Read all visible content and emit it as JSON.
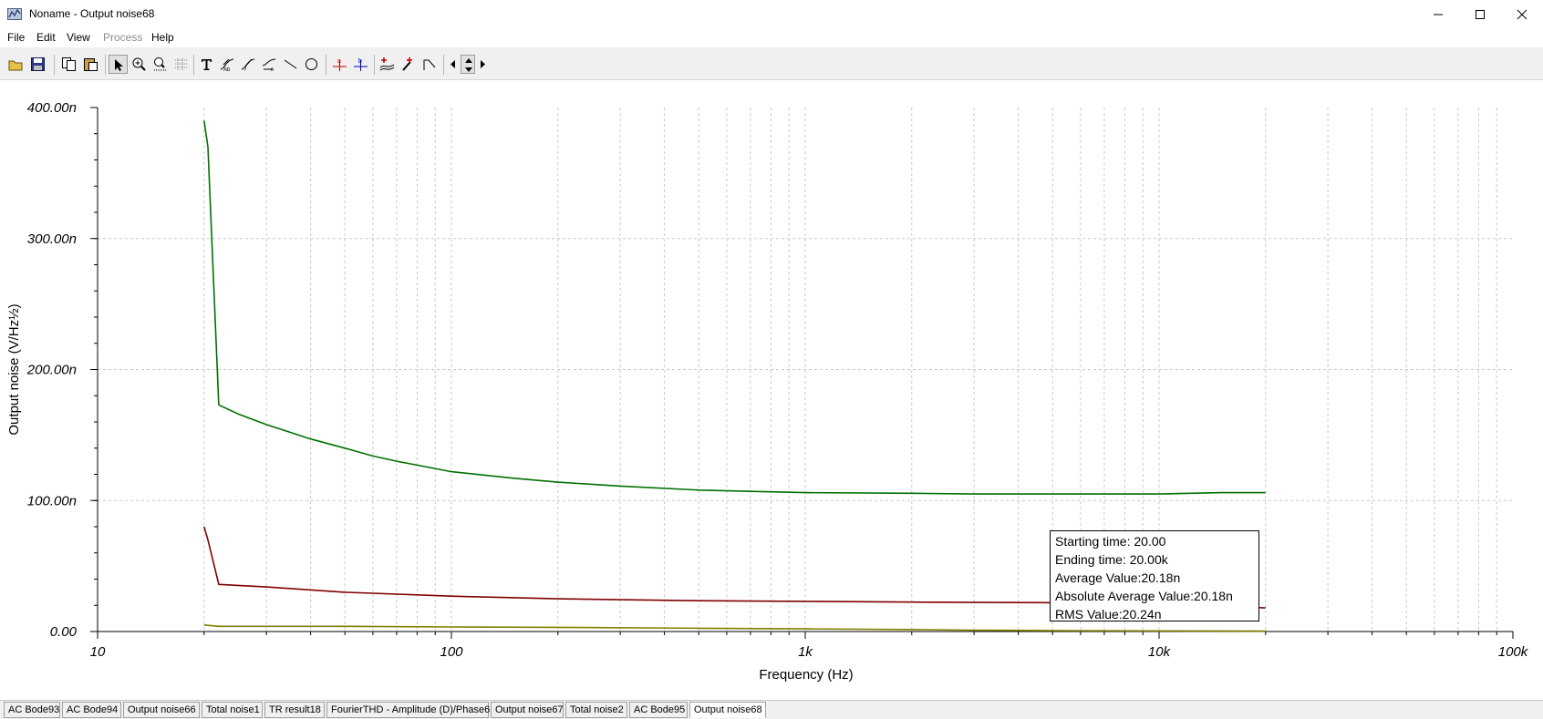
{
  "window": {
    "title": "Noname - Output noise68"
  },
  "menu": [
    {
      "label": "File",
      "enabled": true
    },
    {
      "label": "Edit",
      "enabled": true
    },
    {
      "label": "View",
      "enabled": true
    },
    {
      "label": "Process",
      "enabled": false
    },
    {
      "label": "Help",
      "enabled": true
    }
  ],
  "toolbar": [
    "open-folder-icon",
    "save-icon",
    "copy-icon",
    "paste-icon",
    "pointer-icon",
    "zoom-in-icon",
    "zoom-100-icon",
    "grid-icon",
    "text-icon",
    "curve-label-icon",
    "curve-label-2-icon",
    "curve-label-3-icon",
    "line-icon",
    "ellipse-icon",
    "cursor-a-icon",
    "cursor-b-icon",
    "add-curve-icon",
    "probe-icon",
    "step-icon",
    "arrow-left-icon",
    "arrow-updown-icon",
    "arrow-right-icon"
  ],
  "chart_data": {
    "type": "line",
    "xlabel": "Frequency (Hz)",
    "ylabel": "Output noise (V/Hz½)",
    "xscale": "log",
    "xlim": [
      10,
      100000
    ],
    "ylim": [
      0,
      400
    ],
    "y_unit": "n",
    "x_tick_labels": [
      "10",
      "100",
      "1k",
      "10k",
      "100k"
    ],
    "y_tick_labels": [
      "0.00",
      "100.00n",
      "200.00n",
      "300.00n",
      "400.00n"
    ],
    "grid": true,
    "series": [
      {
        "color": "#007000",
        "points": [
          [
            20,
            390
          ],
          [
            20.5,
            370
          ],
          [
            22,
            173
          ],
          [
            25,
            166
          ],
          [
            30,
            158
          ],
          [
            40,
            147
          ],
          [
            50,
            140
          ],
          [
            60,
            134
          ],
          [
            70,
            130
          ],
          [
            80,
            127
          ],
          [
            100,
            122
          ],
          [
            150,
            117
          ],
          [
            200,
            114
          ],
          [
            300,
            111
          ],
          [
            500,
            108
          ],
          [
            700,
            107
          ],
          [
            1000,
            106
          ],
          [
            2000,
            105.5
          ],
          [
            3000,
            105
          ],
          [
            5000,
            105
          ],
          [
            10000,
            105
          ],
          [
            15000,
            106
          ],
          [
            20000,
            106
          ]
        ]
      },
      {
        "color": "#800000",
        "points": [
          [
            20,
            80
          ],
          [
            20.5,
            70
          ],
          [
            22,
            36
          ],
          [
            30,
            34
          ],
          [
            50,
            30
          ],
          [
            100,
            27
          ],
          [
            200,
            25
          ],
          [
            500,
            23.5
          ],
          [
            1000,
            23
          ],
          [
            2000,
            22.5
          ],
          [
            5000,
            22
          ],
          [
            10000,
            21
          ],
          [
            20000,
            18
          ]
        ]
      },
      {
        "color": "#808000",
        "points": [
          [
            20,
            5
          ],
          [
            22,
            4
          ],
          [
            50,
            4
          ],
          [
            100,
            3.5
          ],
          [
            200,
            3.2
          ],
          [
            500,
            2.5
          ],
          [
            1000,
            2
          ],
          [
            2000,
            1.5
          ],
          [
            3000,
            1
          ],
          [
            5000,
            0.7
          ],
          [
            10000,
            0.5
          ],
          [
            20000,
            0.3
          ]
        ]
      }
    ]
  },
  "info": {
    "start": "Starting time: 20.00",
    "end": "Ending time: 20.00k",
    "avg": "Average Value:20.18n",
    "abs_avg": "Absolute Average Value:20.18n",
    "rms": "RMS Value:20.24n"
  },
  "tabs": [
    {
      "label": "AC Bode93"
    },
    {
      "label": "AC Bode94"
    },
    {
      "label": "Output noise66"
    },
    {
      "label": "Total noise1"
    },
    {
      "label": "TR result18"
    },
    {
      "label": "FourierTHD - Amplitude (D)/Phase6"
    },
    {
      "label": "Output noise67"
    },
    {
      "label": "Total noise2"
    },
    {
      "label": "AC Bode95"
    },
    {
      "label": "Output noise68",
      "active": true
    }
  ]
}
